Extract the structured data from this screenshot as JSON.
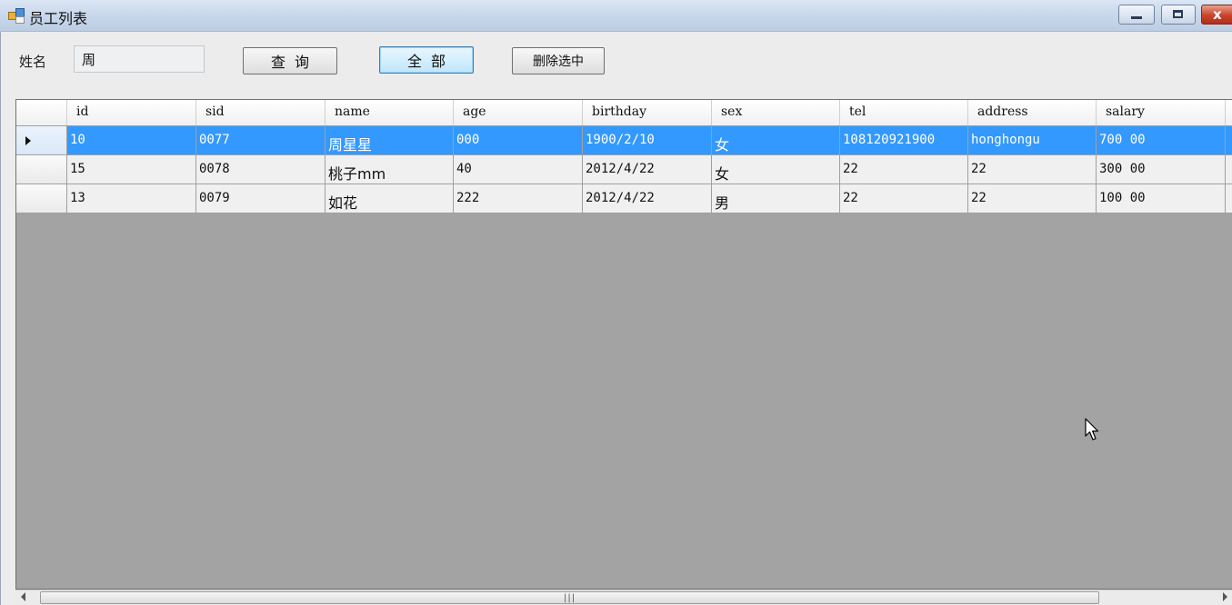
{
  "window": {
    "title": "员工列表",
    "icon": "app-window-icon",
    "controls": [
      "minimize-icon",
      "maximize-icon",
      "close-icon"
    ]
  },
  "search": {
    "label": "姓名",
    "value": "周"
  },
  "buttons": {
    "query": "查询",
    "all": "全部",
    "delete_selected": "删除选中"
  },
  "table": {
    "columns": [
      "id",
      "sid",
      "name",
      "age",
      "birthday",
      "sex",
      "tel",
      "address",
      "salary"
    ],
    "rows": [
      {
        "id": "10",
        "sid": "0077",
        "name": "周星星",
        "age": "000",
        "birthday": "1900/2/10",
        "sex": "女",
        "tel": "108120921900",
        "address": "honghongu",
        "salary": "700 00",
        "selected": true
      },
      {
        "id": "15",
        "sid": "0078",
        "name": "桃子mm",
        "age": "40",
        "birthday": "2012/4/22",
        "sex": "女",
        "tel": "22",
        "address": "22",
        "salary": "300 00",
        "selected": false
      },
      {
        "id": "13",
        "sid": "0079",
        "name": "如花",
        "age": "222",
        "birthday": "2012/4/22",
        "sex": "男",
        "tel": "22",
        "address": "22",
        "salary": "100 00",
        "selected": false
      }
    ]
  },
  "colors": {
    "selection": "#3399ff",
    "grid_background": "#a3a3a3",
    "title_bar": "#c7d6ea",
    "close_button": "#c9432b"
  }
}
